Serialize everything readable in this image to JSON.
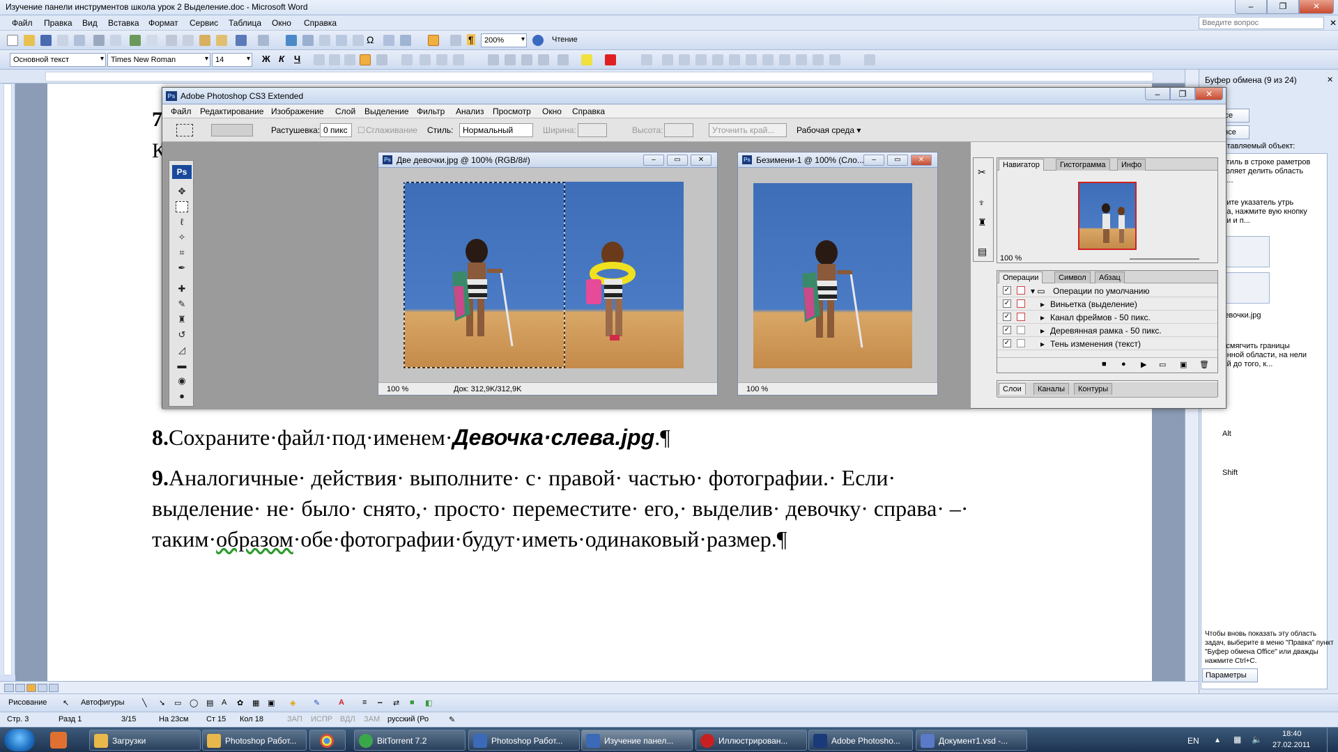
{
  "word": {
    "title": "Изучение панели инструментов школа урок 2 Выделение.doc - Microsoft Word",
    "menu": [
      "Файл",
      "Правка",
      "Вид",
      "Вставка",
      "Формат",
      "Сервис",
      "Таблица",
      "Окно",
      "Справка"
    ],
    "help_placeholder": "Введите вопрос",
    "toolbar1": {
      "zoom": "200%",
      "read_label": "Чтение"
    },
    "toolbar2": {
      "style": "Основной текст",
      "font": "Times New Roman",
      "size": "14"
    },
    "doc": {
      "para8_num": "8.",
      "para8_text": "Сохраните·файл·под·именем·",
      "para8_file": "Девочка·слева.jpg",
      "para8_end": ".¶",
      "para9_num": "9.",
      "para9_line1": "Аналогичные· действия· выполните· с· правой· частью· фотографии.· Если·",
      "para9_line2": "выделение· не· было· снято,· просто· переместите· его,· выделив· девочку· справа· –·",
      "para9_line3a": "таким·",
      "para9_line3b": "образом",
      "para9_line3c": "·обе·фотографии·будут·иметь·одинаковый·размер.¶",
      "edge_a": "7",
      "edge_b": "К"
    },
    "drawbar": {
      "draw": "Рисование",
      "autoshapes": "Автофигуры"
    },
    "status": {
      "page": "Стр. 3",
      "section": "Разд 1",
      "pages": "3/15",
      "at": "На 23см",
      "line": "Ст 15",
      "col": "Кол 18",
      "rec": "ЗАП",
      "trk": "ИСПР",
      "ext": "ВДЛ",
      "ovr": "ЗАМ",
      "lang": "русский (Ро"
    },
    "taskpane": {
      "title": "Буфер обмена (9 из 24)",
      "paste_all": "вить все",
      "clear_all": "стить все",
      "hint": "ите вставляемый объект:",
      "items": [
        "ле Стиль в строке раметров позволяет делить область прои...",
        "местите указатель утрь овала, нажмите вую кнопку мыши и п...",
        "ве девочки.jpg",
        "обы смягчить границы деленной области, на нели опций до того, к...",
        "hift",
        "Alt",
        "Shift"
      ],
      "footer": "Чтобы вновь показать эту область задач, выберите в меню \"Правка\" пункт \"Буфер обмена Office\" или дважды нажмите Ctrl+C.",
      "params": "Параметры"
    }
  },
  "photoshop": {
    "title": "Adobe Photoshop CS3 Extended",
    "menu": [
      "Файл",
      "Редактирование",
      "Изображение",
      "Слой",
      "Выделение",
      "Фильтр",
      "Анализ",
      "Просмотр",
      "Окно",
      "Справка"
    ],
    "options": {
      "feather_label": "Растушевка:",
      "feather_value": "0 пикс",
      "antialias": "Сглаживание",
      "style_label": "Стиль:",
      "style_value": "Нормальный",
      "width_label": "Ширина:",
      "height_label": "Высота:",
      "refine": "Уточнить край...",
      "workspace": "Рабочая среда"
    },
    "doc1": {
      "title": "Две девочки.jpg @ 100% (RGB/8#)",
      "zoom": "100 %",
      "info": "Док: 312,9K/312,9K"
    },
    "doc2": {
      "title": "Безимени-1 @ 100% (Сло...",
      "zoom": "100 %"
    },
    "navigator": {
      "tabs": [
        "Навигатор",
        "Гистограмма",
        "Инфо"
      ],
      "zoom": "100 %"
    },
    "actions": {
      "tabs": [
        "Операции",
        "Символ",
        "Абзац"
      ],
      "set": "Операции по умолчанию",
      "items": [
        "Виньетка (выделение)",
        "Канал фреймов - 50 пикс.",
        "Деревянная рамка - 50 пикс.",
        "Тень изменения (текст)"
      ]
    },
    "layers": {
      "tabs": [
        "Слои",
        "Каналы",
        "Контуры"
      ]
    }
  },
  "taskbar": {
    "items": [
      {
        "label": "Загрузки",
        "color": "#e8b84a"
      },
      {
        "label": "Photoshop Работ...",
        "color": "#e8b84a"
      },
      {
        "label": "",
        "color": "#d84a3a"
      },
      {
        "label": "BitTorrent 7.2",
        "color": "#3aa84a"
      },
      {
        "label": "Photoshop Работ...",
        "color": "#3a6ab8"
      },
      {
        "label": "Изучение панел...",
        "color": "#3a6ab8"
      },
      {
        "label": "Иллюстрирован...",
        "color": "#c82020"
      },
      {
        "label": "Adobe Photosho...",
        "color": "#1a3a7a"
      },
      {
        "label": "Документ1.vsd -...",
        "color": "#5a7ac8"
      }
    ],
    "lang": "EN",
    "time": "18:40",
    "date": "27.02.2011"
  }
}
